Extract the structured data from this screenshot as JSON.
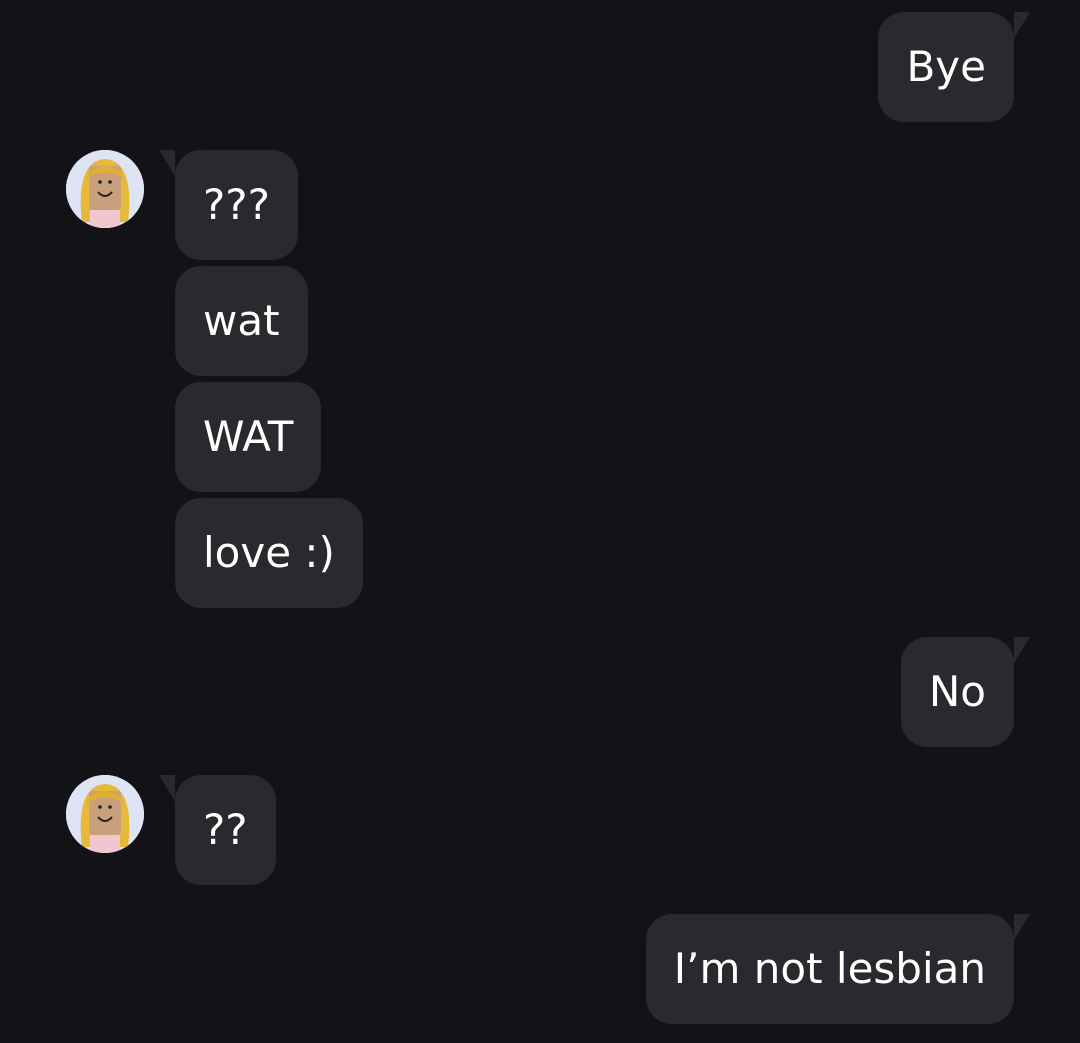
{
  "conversation": {
    "messages": [
      {
        "direction": "outgoing",
        "text": "Bye"
      },
      {
        "direction": "incoming",
        "text": "???"
      },
      {
        "direction": "incoming",
        "text": "wat"
      },
      {
        "direction": "incoming",
        "text": "WAT"
      },
      {
        "direction": "incoming",
        "text": "love :)"
      },
      {
        "direction": "outgoing",
        "text": "No"
      },
      {
        "direction": "incoming",
        "text": "??"
      },
      {
        "direction": "outgoing",
        "text": "I’m not lesbian"
      }
    ]
  },
  "colors": {
    "background": "#121217",
    "bubble": "#29292e",
    "text": "#ffffff",
    "avatar_bg": "#dfe4f5"
  },
  "icons": {
    "avatar": "contact-avatar-icon"
  }
}
